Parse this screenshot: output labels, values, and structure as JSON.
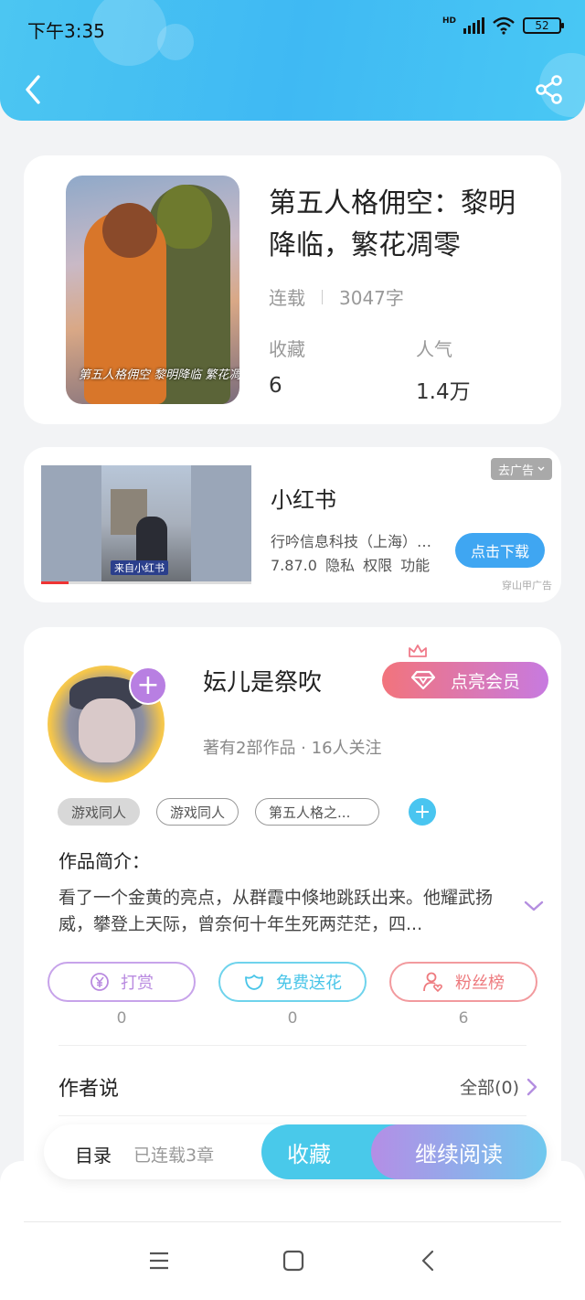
{
  "status_bar": {
    "time": "下午3:35",
    "battery": "52",
    "network": "HD"
  },
  "book": {
    "title": "第五人格佣空：黎明降临，繁花凋零",
    "status": "连载",
    "word_count": "3047字",
    "favorites_label": "收藏",
    "favorites_value": "6",
    "popularity_label": "人气",
    "popularity_value": "1.4万",
    "cover_text": "第五人格佣空  黎明降临 繁花凋零"
  },
  "ad": {
    "app_name": "小红书",
    "company": "行吟信息科技（上海）有限公司",
    "meta": "7.87.0 隐私 权限 功能",
    "close_label": "去广告",
    "download_label": "点击下载",
    "source": "穿山甲广告",
    "video_tag": "来自小红书"
  },
  "author": {
    "name": "妘儿是祭吹",
    "vip_label": "点亮会员",
    "summary": "著有2部作品 · 16人关注",
    "tags": [
      "游戏同人",
      "游戏同人",
      "第五人格之..."
    ],
    "intro_label": "作品简介：",
    "intro_text": "看了一个金黄的亮点，从群霞中倏地跳跃出来。他耀武扬威，攀登上天际，曾奈何十年生死两茫茫，四..."
  },
  "actions": [
    {
      "label": "打赏",
      "count": "0",
      "color": "#b98ae0"
    },
    {
      "label": "免费送花",
      "count": "0",
      "color": "#49c5e8"
    },
    {
      "label": "粉丝榜",
      "count": "6",
      "color": "#ee7b7f"
    }
  ],
  "author_says": {
    "label": "作者说",
    "all_label": "全部(0)"
  },
  "read_bar": {
    "toc_label": "目录",
    "chapters": "已连载3章",
    "favorite_label": "收藏",
    "continue_label": "继续阅读"
  },
  "icons": {
    "back": "chevron-left-icon",
    "share": "share-icon",
    "plus": "plus-icon",
    "diamond": "diamond-icon",
    "coin": "coin-icon",
    "flower": "flower-icon",
    "fans": "user-heart-icon",
    "expand": "chevron-down-icon",
    "more": "chevron-right-icon"
  }
}
